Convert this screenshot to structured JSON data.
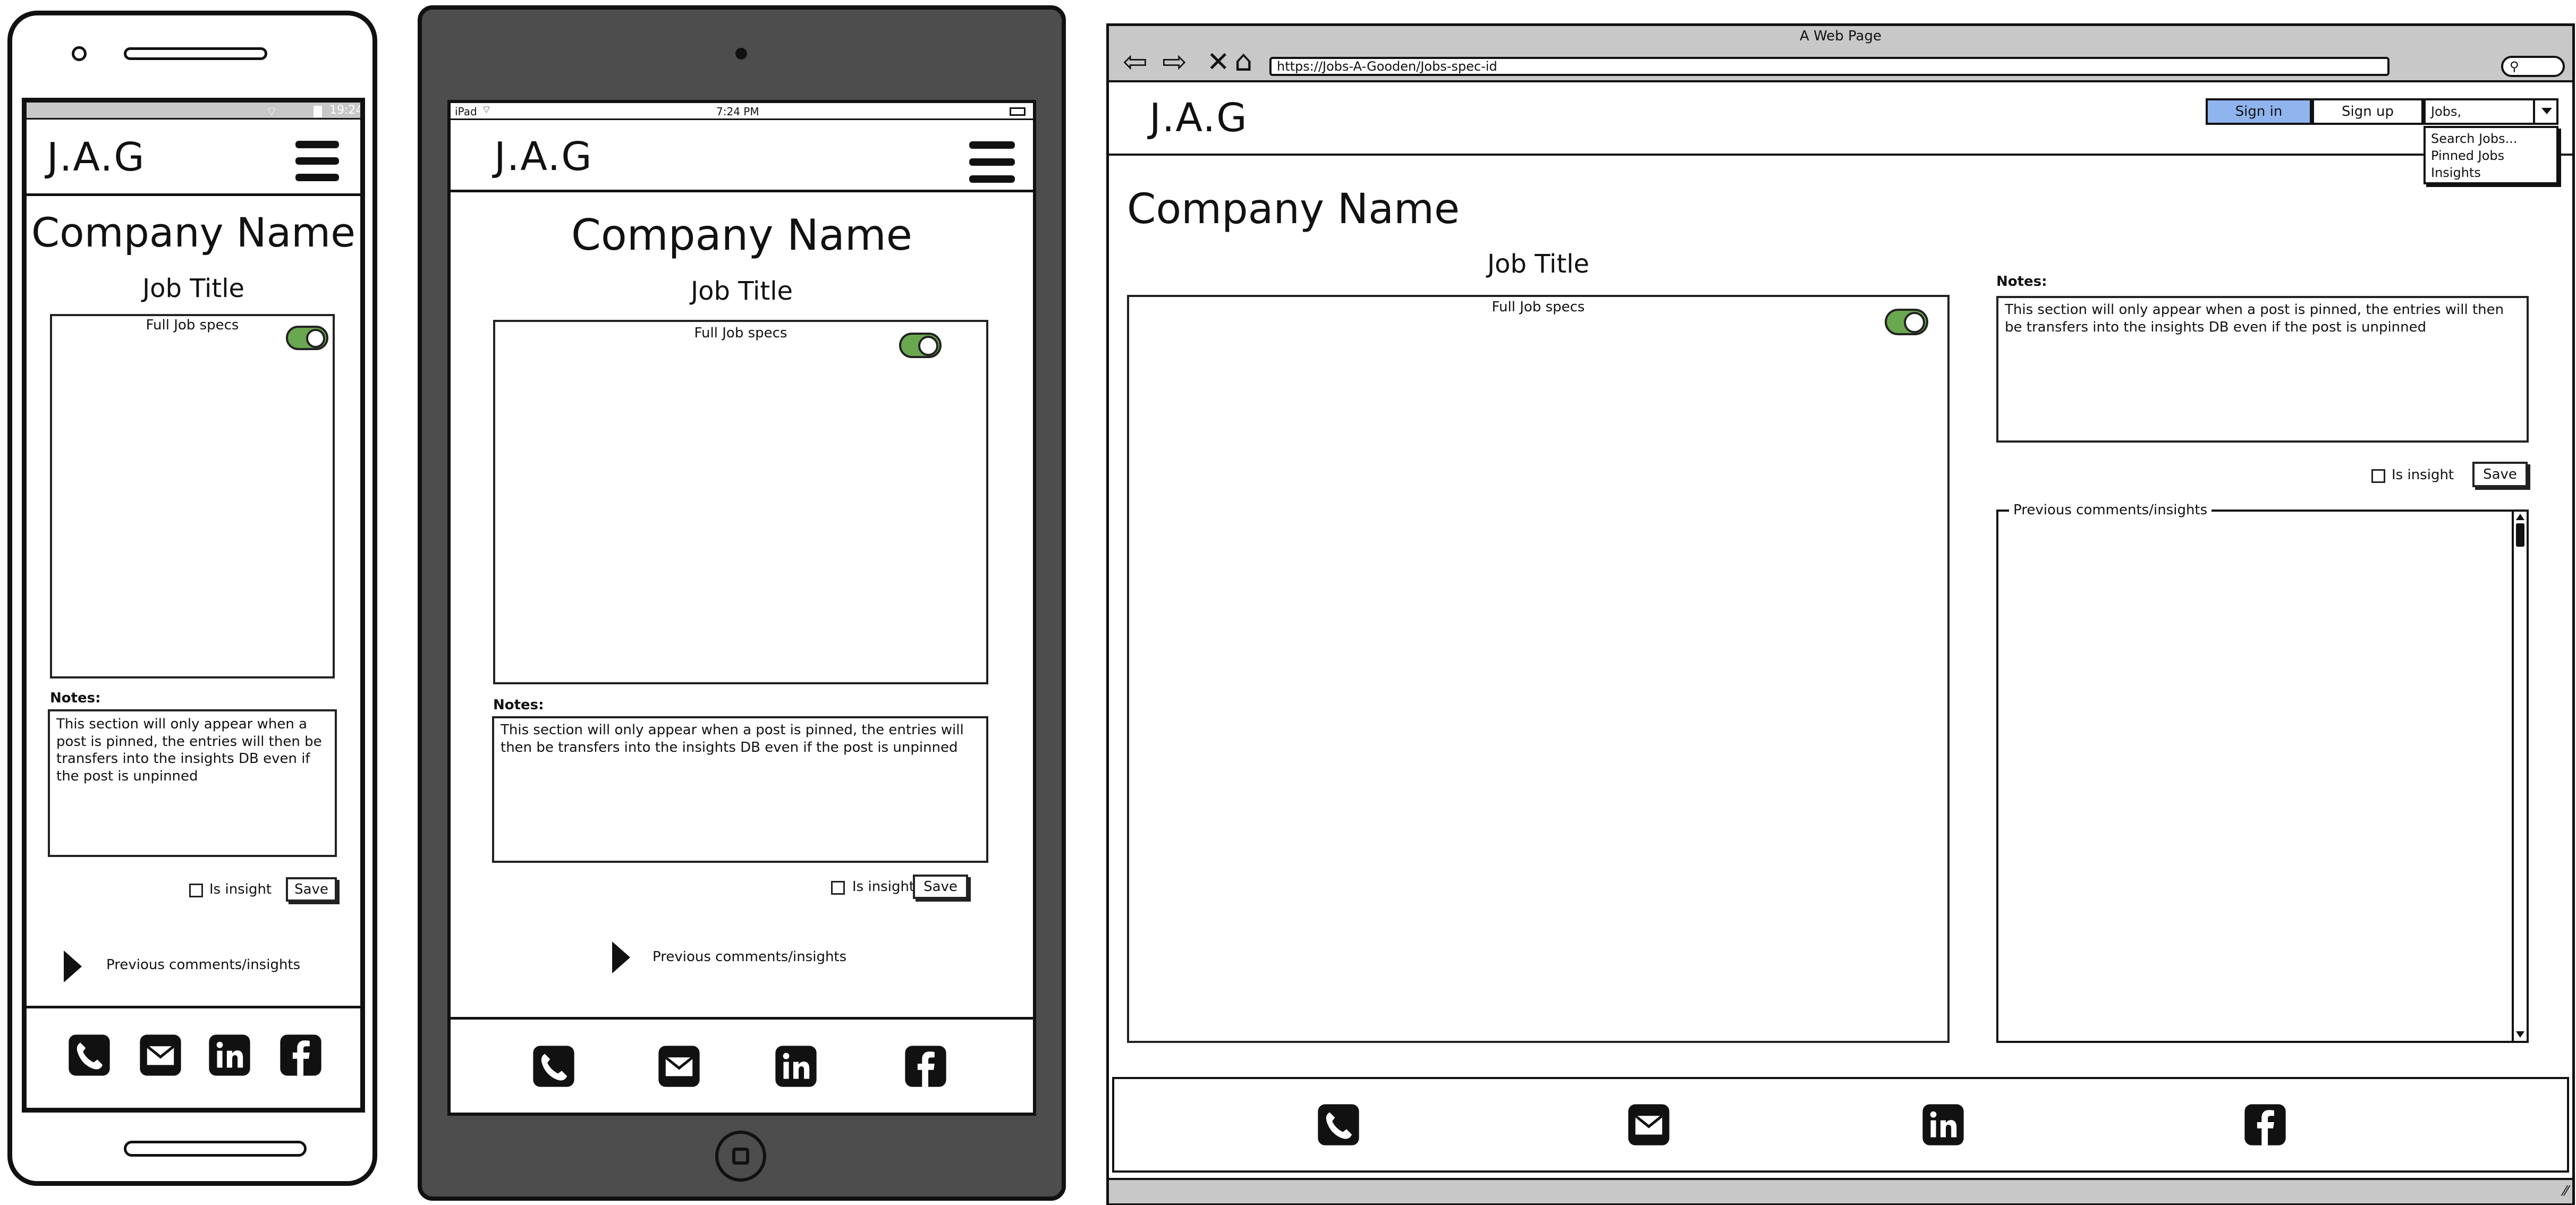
{
  "brand": "J.A.G",
  "company_name": "Company Name",
  "job_title": "Job Title",
  "full_job_specs": "Full Job specs",
  "notes_label": "Notes:",
  "notes_text": "This section will only appear when a post is pinned, the entries will then be transfers into the insights DB even if the post is unpinned",
  "is_insight": "Is insight",
  "save": "Save",
  "previous_comments": "Previous comments/insights",
  "phone_status_time": "19:24",
  "tablet_status": {
    "device": "iPad",
    "time": "7:24 PM"
  },
  "browser": {
    "title": "A Web Page",
    "url": "https://Jobs-A-Gooden/Jobs-spec-id",
    "sign_in": "Sign in",
    "sign_up": "Sign up",
    "dropdown_value": "Jobs,",
    "dropdown_options": [
      "Search Jobs...",
      "Pinned Jobs",
      "Insights"
    ]
  },
  "colors": {
    "toggle_on": "#6aa84f",
    "sign_in_bg": "#8fb4ee",
    "tablet_frame": "#4d4d4d",
    "chrome": "#c8c8c8"
  },
  "icons": [
    "phone-icon",
    "mail-icon",
    "linkedin-icon",
    "facebook-icon"
  ]
}
